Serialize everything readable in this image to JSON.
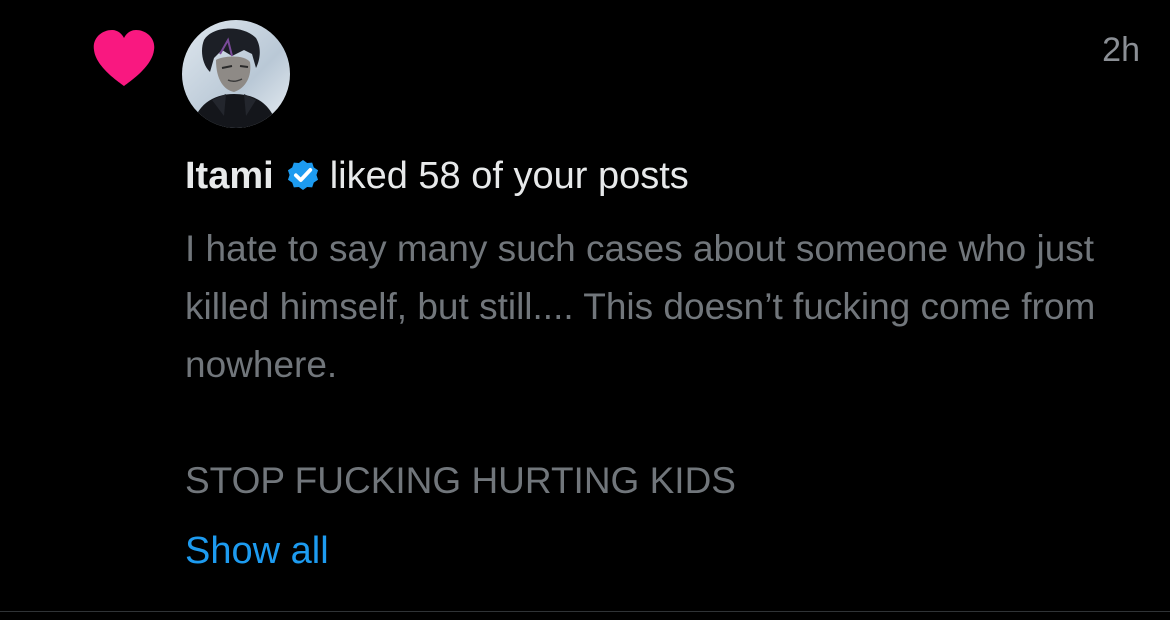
{
  "notification": {
    "type_icon": "heart-icon",
    "type_icon_color": "#f91880",
    "timestamp": "2h",
    "user": {
      "name": "Itami",
      "verified": true,
      "verified_color": "#1d9bf0"
    },
    "action_text": "liked 58 of your posts",
    "post": {
      "paragraph_1": "I hate to say many such cases about someone who just killed himself, but still.... This doesn’t fucking come from nowhere.",
      "paragraph_2": "STOP FUCKING HURTING KIDS"
    },
    "show_all_label": "Show all",
    "link_color": "#1d9bf0"
  }
}
